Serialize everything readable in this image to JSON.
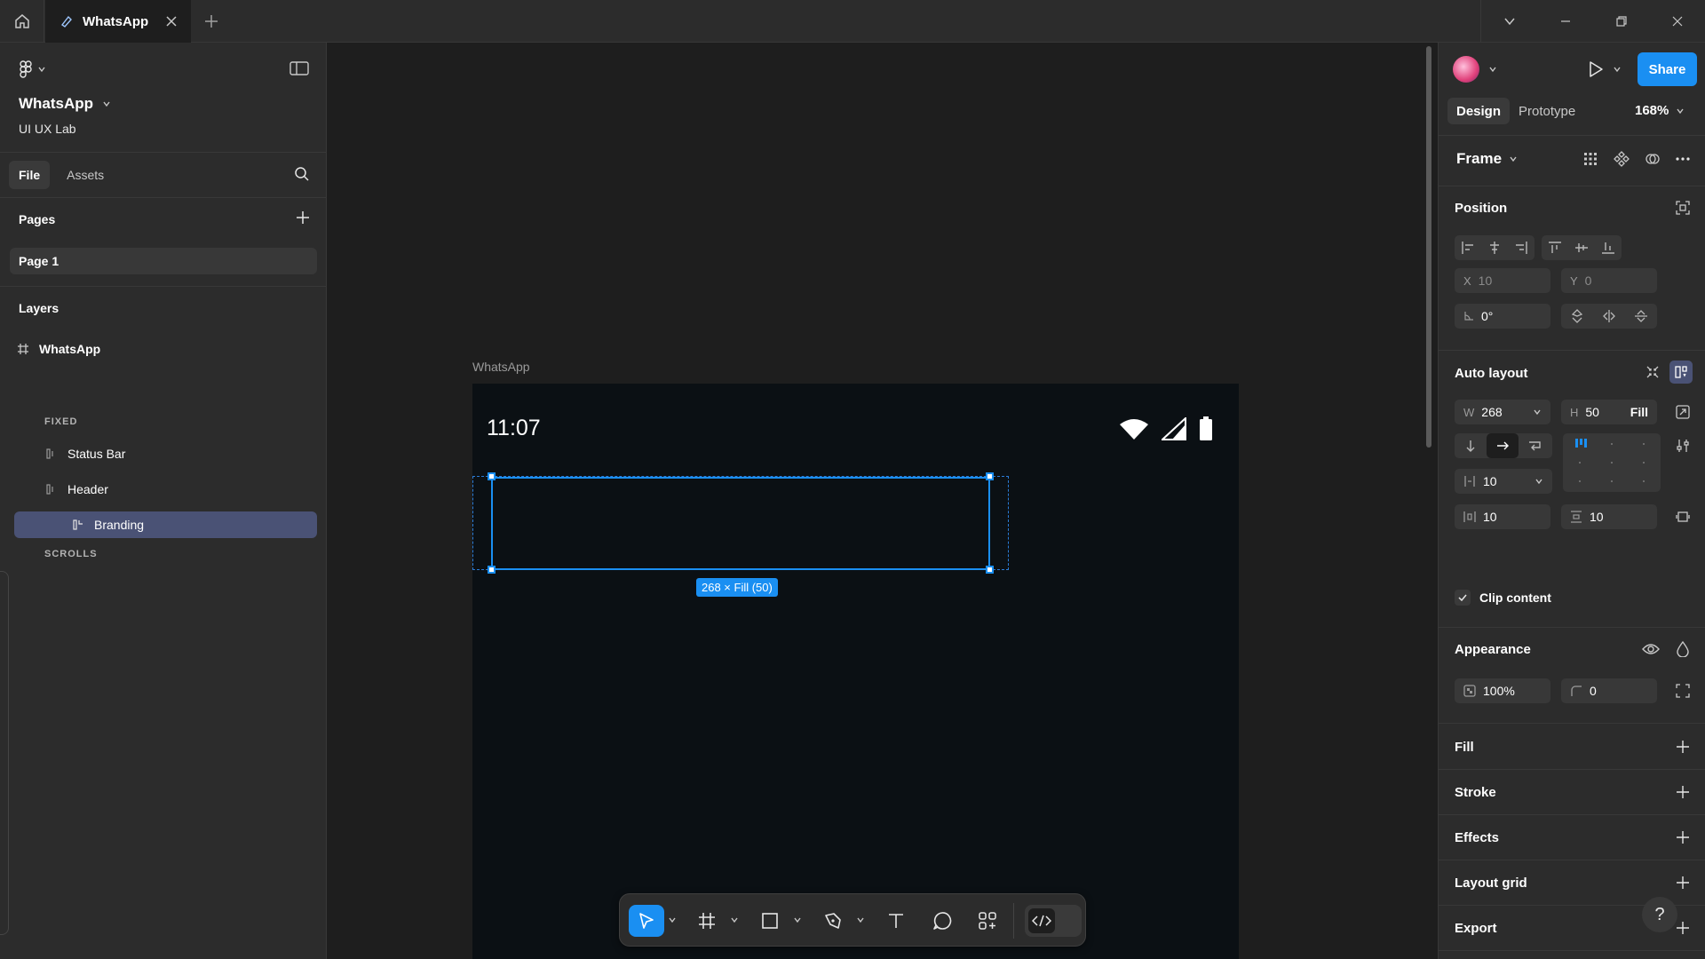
{
  "titlebar": {
    "tab_label": "WhatsApp"
  },
  "left": {
    "file_name": "WhatsApp",
    "team": "UI UX Lab",
    "tabs": [
      "File",
      "Assets"
    ],
    "pages_title": "Pages",
    "page_item": "Page 1",
    "layers_title": "Layers",
    "root_layer": "WhatsApp",
    "group_fixed": "FIXED",
    "layer_status_bar": "Status Bar",
    "layer_header": "Header",
    "layer_branding": "Branding",
    "group_scrolls": "SCROLLS"
  },
  "canvas": {
    "frame_label": "WhatsApp",
    "status_time": "11:07",
    "size_badge": "268 × Fill (50)"
  },
  "right": {
    "share": "Share",
    "tabs": [
      "Design",
      "Prototype"
    ],
    "zoom": "168%",
    "frame_title": "Frame",
    "position_title": "Position",
    "x_label": "X",
    "x_value": "10",
    "y_label": "Y",
    "y_value": "0",
    "rotation": "0°",
    "auto_layout_title": "Auto layout",
    "w_label": "W",
    "w_value": "268",
    "h_label": "H",
    "h_value": "50",
    "h_mode": "Fill",
    "gap": "10",
    "padding_h": "10",
    "padding_v": "10",
    "clip_content": "Clip content",
    "appearance_title": "Appearance",
    "opacity": "100%",
    "radius": "0",
    "sections": [
      "Fill",
      "Stroke",
      "Effects",
      "Layout grid",
      "Export"
    ],
    "help": "?"
  },
  "colors": {
    "accent": "#1a8ff2",
    "panel": "#2c2c2c",
    "canvas": "#1e1e1e",
    "frame": "#0b1014",
    "layer_selected": "#4a5275"
  },
  "icons": [
    "home-icon",
    "figma-file-icon",
    "close-icon",
    "plus-icon",
    "chevron-down-icon",
    "figma-logo-icon",
    "sidebar-toggle-icon",
    "search-icon",
    "frame-hash-icon",
    "auto-layout-icon",
    "wifi-icon",
    "signal-icon",
    "battery-icon",
    "move-tool-icon",
    "frame-tool-icon",
    "rectangle-tool-icon",
    "pen-tool-icon",
    "text-tool-icon",
    "comment-tool-icon",
    "actions-tool-icon",
    "dev-mode-icon",
    "play-icon",
    "eye-icon",
    "drop-icon"
  ]
}
